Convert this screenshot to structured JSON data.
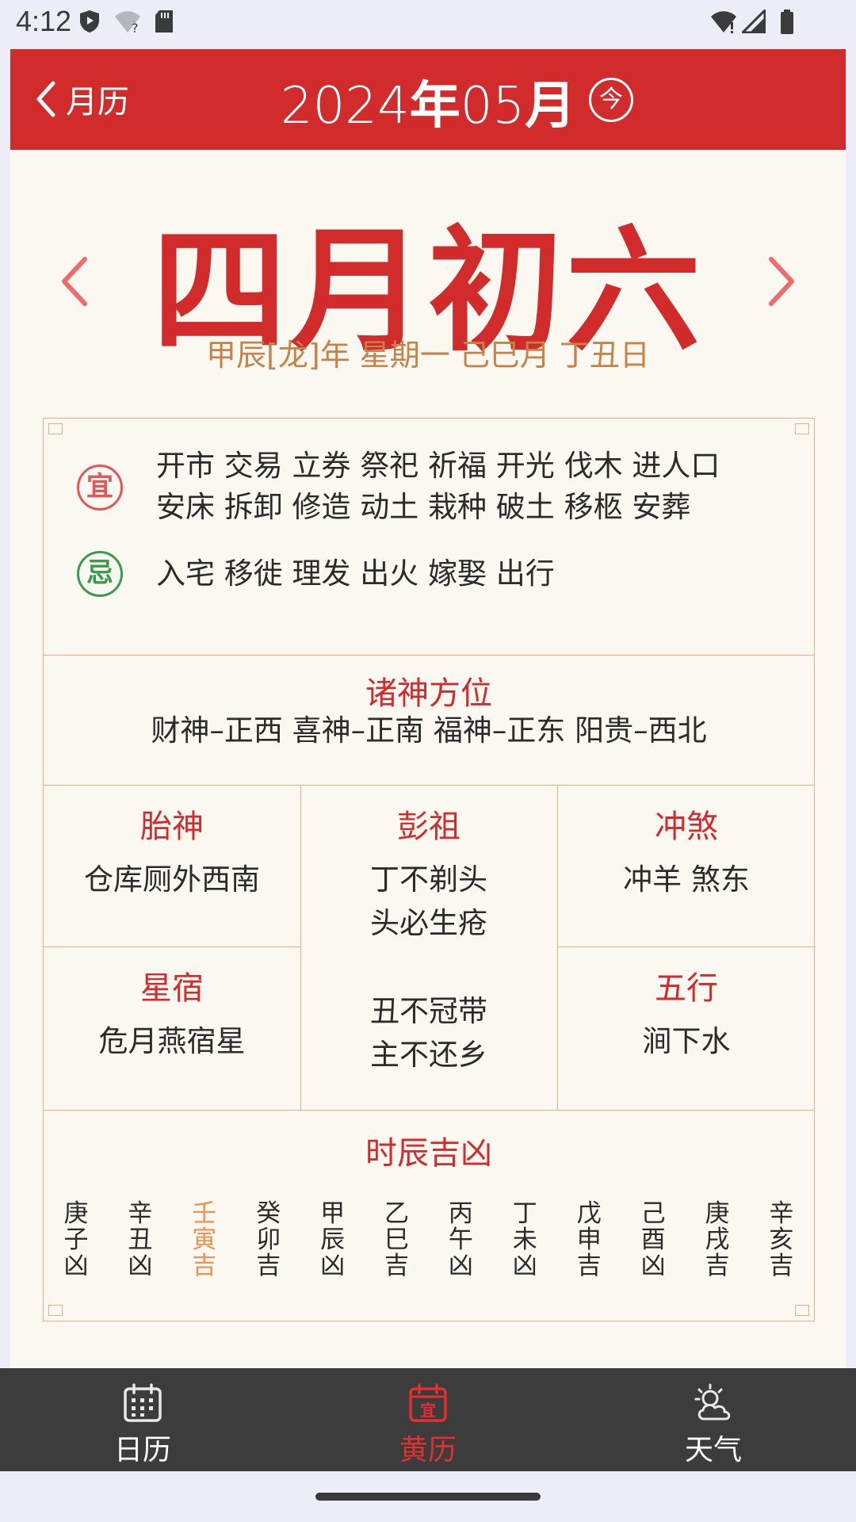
{
  "status_bar": {
    "time": "4:12"
  },
  "header": {
    "back_label": "月历",
    "year": "2024",
    "year_suffix": "年",
    "month": "05",
    "month_suffix": "月",
    "today_button": "今",
    "bg_color": "#d22b2b"
  },
  "day": {
    "lunar_date": "四月初六",
    "ganzhi_line": "甲辰[龙]年 星期一 己巳月 丁丑日"
  },
  "yi_ji": {
    "yi_badge": "宜",
    "yi_line1": "开市 交易 立券 祭祀 祈福 开光 伐木 进人口",
    "yi_line2": "安床 拆卸 修造 动土 栽种 破土 移柩 安葬",
    "ji_badge": "忌",
    "ji_line1": "入宅 移徙 理发 出火 嫁娶 出行"
  },
  "shen_position": {
    "title": "诸神方位",
    "text": "财神–正西 喜神–正南 福神–正东 阳贵–西北"
  },
  "taishen": {
    "title": "胎神",
    "text": "仓库厕外西南"
  },
  "pengzu": {
    "title": "彭祖",
    "line1": "丁不剃头",
    "line2": "头必生疮",
    "line3": "丑不冠带",
    "line4": "主不还乡"
  },
  "chongsha": {
    "title": "冲煞",
    "text": "冲羊 煞东"
  },
  "xingxiu": {
    "title": "星宿",
    "text": "危月燕宿星"
  },
  "wuxing": {
    "title": "五行",
    "text": "涧下水"
  },
  "shichen": {
    "title": "时辰吉凶",
    "items": [
      {
        "stem": "庚",
        "branch": "子",
        "luck": "凶",
        "highlight": false
      },
      {
        "stem": "辛",
        "branch": "丑",
        "luck": "凶",
        "highlight": false
      },
      {
        "stem": "壬",
        "branch": "寅",
        "luck": "吉",
        "highlight": true
      },
      {
        "stem": "癸",
        "branch": "卯",
        "luck": "吉",
        "highlight": false
      },
      {
        "stem": "甲",
        "branch": "辰",
        "luck": "凶",
        "highlight": false
      },
      {
        "stem": "乙",
        "branch": "巳",
        "luck": "吉",
        "highlight": false
      },
      {
        "stem": "丙",
        "branch": "午",
        "luck": "凶",
        "highlight": false
      },
      {
        "stem": "丁",
        "branch": "未",
        "luck": "凶",
        "highlight": false
      },
      {
        "stem": "戊",
        "branch": "申",
        "luck": "吉",
        "highlight": false
      },
      {
        "stem": "己",
        "branch": "酉",
        "luck": "凶",
        "highlight": false
      },
      {
        "stem": "庚",
        "branch": "戌",
        "luck": "吉",
        "highlight": false
      },
      {
        "stem": "辛",
        "branch": "亥",
        "luck": "吉",
        "highlight": false
      }
    ]
  },
  "bottom_nav": {
    "tabs": [
      {
        "label": "日历",
        "icon": "calendar-icon",
        "active": false
      },
      {
        "label": "黄历",
        "icon": "almanac-icon",
        "active": true
      },
      {
        "label": "天气",
        "icon": "weather-icon",
        "active": false
      }
    ]
  },
  "colors": {
    "accent_red": "#d22b2b",
    "ganzhi_brown": "#c48347",
    "border": "#e3b08d",
    "highlight_orange": "#ee9252",
    "yi_red": "#e0575a",
    "ji_green": "#3c9a4e"
  }
}
